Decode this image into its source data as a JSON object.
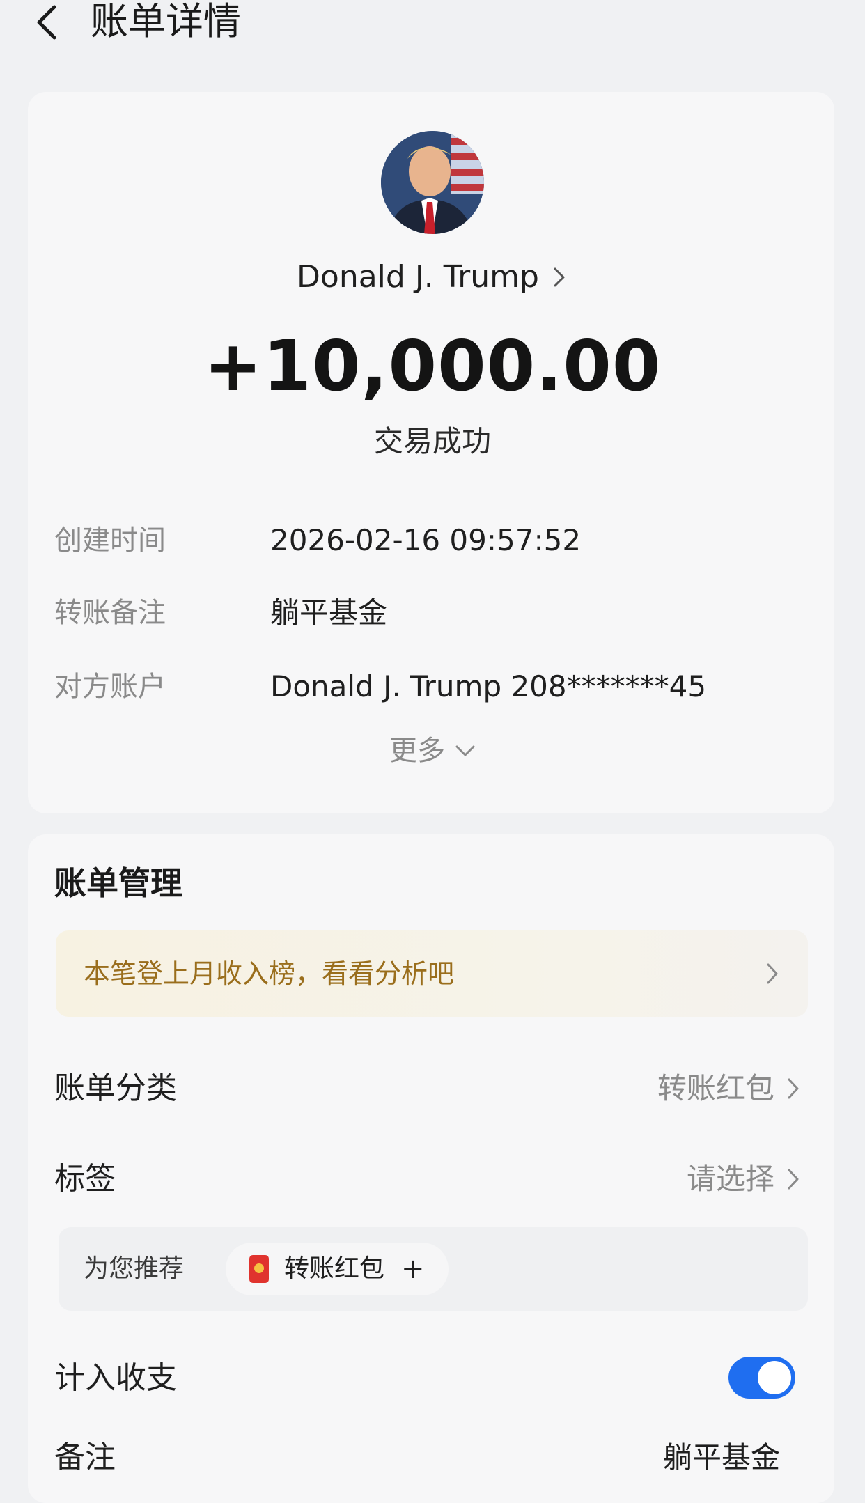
{
  "header": {
    "title": "账单详情",
    "back_icon": "chevron-left-icon"
  },
  "summary": {
    "payee_name": "Donald J. Trump",
    "amount": "+10,000.00",
    "status": "交易成功"
  },
  "details": [
    {
      "label": "创建时间",
      "value": "2026-02-16 09:57:52"
    },
    {
      "label": "转账备注",
      "value": "躺平基金"
    },
    {
      "label": "对方账户",
      "value": "Donald J. Trump 208*******45"
    }
  ],
  "more_label": "更多",
  "management": {
    "title": "账单管理",
    "banner_text": "本笔登上月收入榜，看看分析吧",
    "category": {
      "label": "账单分类",
      "value": "转账红包"
    },
    "tags": {
      "label": "标签",
      "value": "请选择"
    },
    "recommend": {
      "label": "为您推荐",
      "chip_label": "转账红包",
      "chip_action": "+"
    },
    "include": {
      "label": "计入收支",
      "enabled": true
    },
    "note": {
      "label": "备注",
      "value": "躺平基金"
    }
  },
  "colors": {
    "accent": "#1f6ef0",
    "banner_text": "#9a6e1c",
    "red_packet": "#e0332e"
  }
}
